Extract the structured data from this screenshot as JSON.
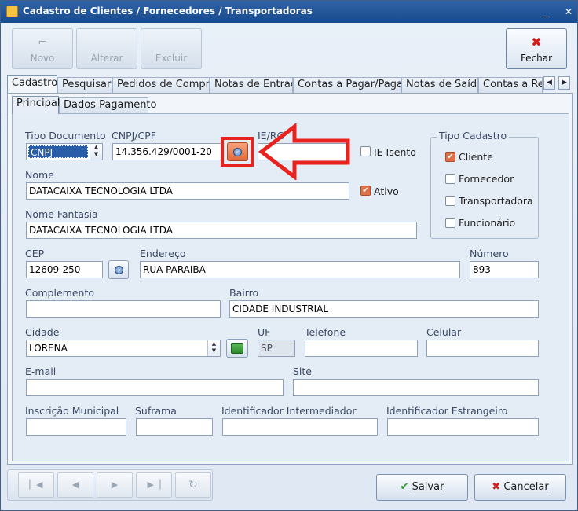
{
  "window": {
    "title": "Cadastro de Clientes / Fornecedores / Transportadoras"
  },
  "toolbar": {
    "novo": "Novo",
    "alterar": "Alterar",
    "excluir": "Excluir",
    "fechar": "Fechar"
  },
  "tabs": [
    "Cadastro",
    "Pesquisar",
    "Pedidos de Compra",
    "Notas de Entrada",
    "Contas a Pagar/Pagas",
    "Notas de Saída",
    "Contas a Rec"
  ],
  "subtabs": [
    "Principal",
    "Dados Pagamento"
  ],
  "form": {
    "tipo_documento": {
      "label": "Tipo Documento",
      "value": "CNPJ"
    },
    "cnpj_cpf": {
      "label": "CNPJ/CPF",
      "value": "14.356.429/0001-20"
    },
    "ie_rg": {
      "label": "IE/RG",
      "value": ""
    },
    "ie_isento": {
      "label": "IE Isento",
      "checked": false
    },
    "nome": {
      "label": "Nome",
      "value": "DATACAIXA TECNOLOGIA LTDA"
    },
    "ativo": {
      "label": "Ativo",
      "checked": true
    },
    "nome_fantasia": {
      "label": "Nome Fantasia",
      "value": "DATACAIXA TECNOLOGIA LTDA"
    },
    "cep": {
      "label": "CEP",
      "value": "12609-250"
    },
    "endereco": {
      "label": "Endereço",
      "value": "RUA PARAIBA"
    },
    "numero": {
      "label": "Número",
      "value": "893"
    },
    "complemento": {
      "label": "Complemento",
      "value": ""
    },
    "bairro": {
      "label": "Bairro",
      "value": "CIDADE INDUSTRIAL"
    },
    "cidade": {
      "label": "Cidade",
      "value": "LORENA"
    },
    "uf": {
      "label": "UF",
      "value": "SP"
    },
    "telefone": {
      "label": "Telefone",
      "value": ""
    },
    "celular": {
      "label": "Celular",
      "value": ""
    },
    "email": {
      "label": "E-mail",
      "value": ""
    },
    "site": {
      "label": "Site",
      "value": ""
    },
    "inscricao_municipal": {
      "label": "Inscrição Municipal",
      "value": ""
    },
    "suframa": {
      "label": "Suframa",
      "value": ""
    },
    "identificador_intermediador": {
      "label": "Identificador Intermediador",
      "value": ""
    },
    "identificador_estrangeiro": {
      "label": "Identificador Estrangeiro",
      "value": ""
    }
  },
  "tipo_cadastro": {
    "title": "Tipo Cadastro",
    "options": [
      {
        "label": "Cliente",
        "checked": true
      },
      {
        "label": "Fornecedor",
        "checked": false
      },
      {
        "label": "Transportadora",
        "checked": false
      },
      {
        "label": "Funcionário",
        "checked": false
      }
    ]
  },
  "footer": {
    "salvar": "Salvar",
    "cancelar": "Cancelar"
  },
  "colors": {
    "accent": "#e8231f",
    "title_bar": "#1f5398",
    "check": "#e07048"
  }
}
